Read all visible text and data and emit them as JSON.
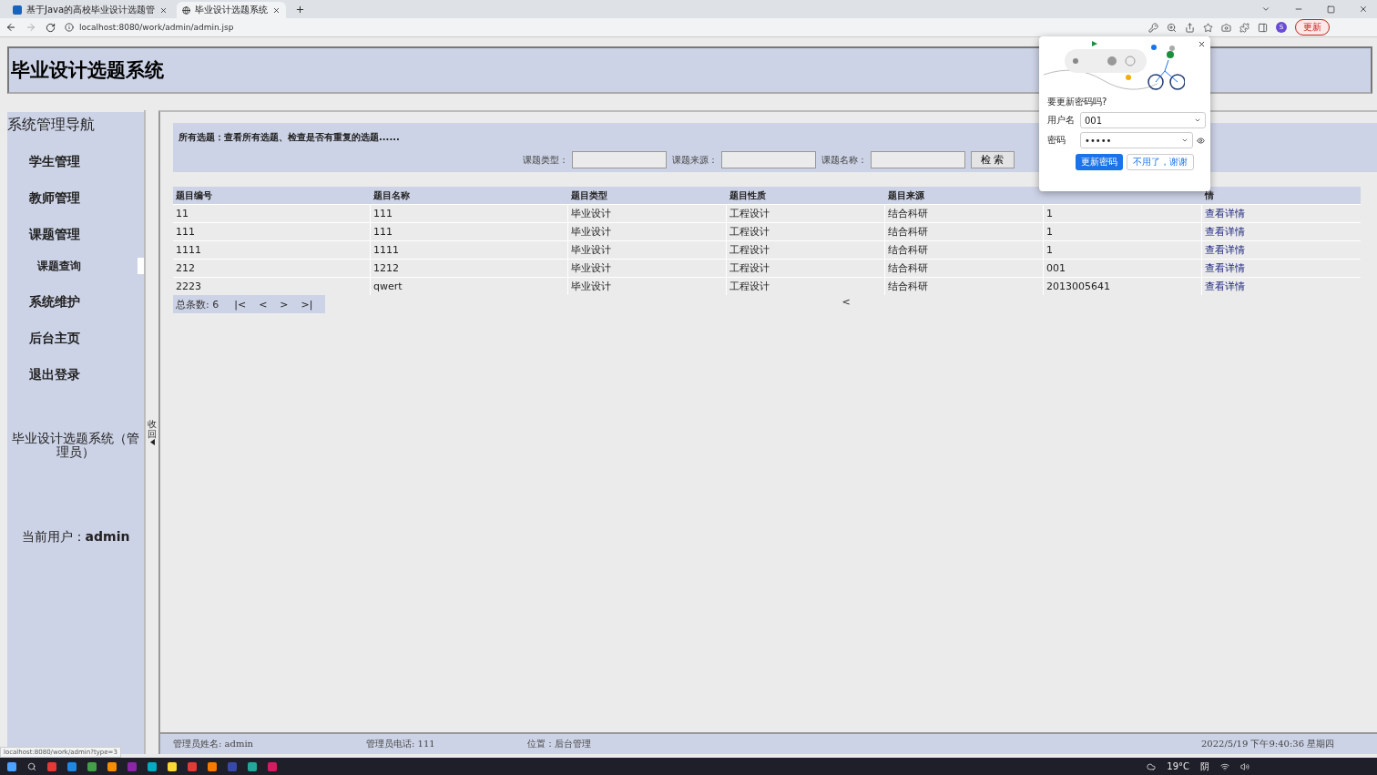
{
  "browser": {
    "tabs": [
      {
        "title": "基于Java的高校毕业设计选题管",
        "selected": false
      },
      {
        "title": "毕业设计选题系统",
        "selected": true
      }
    ],
    "url": "localhost:8080/work/admin/admin.jsp",
    "profile": "S",
    "update_button": "更新"
  },
  "header": {
    "title": "毕业设计选题系统"
  },
  "sidebar": {
    "heading": "系统管理导航",
    "items": [
      {
        "label": "学生管理",
        "kind": "main",
        "selected": false
      },
      {
        "label": "教师管理",
        "kind": "main",
        "selected": false
      },
      {
        "label": "课题管理",
        "kind": "main",
        "selected": false
      },
      {
        "label": "课题查询",
        "kind": "sub",
        "selected": true
      },
      {
        "label": "系统维护",
        "kind": "main",
        "selected": false
      },
      {
        "label": "后台主页",
        "kind": "main",
        "selected": false
      },
      {
        "label": "退出登录",
        "kind": "main",
        "selected": false
      }
    ],
    "note": "毕业设计选题系统（管理员）",
    "user_label": "当前用户：",
    "user": "admin",
    "collapse": "收回"
  },
  "search": {
    "description": "所有选题：查看所有选题、检查是否有重复的选题......",
    "fields": [
      {
        "label": "课题类型："
      },
      {
        "label": "课题来源："
      },
      {
        "label": "课题名称："
      }
    ],
    "button": "检 索"
  },
  "table": {
    "columns": [
      {
        "label": "题目编号"
      },
      {
        "label": "题目名称"
      },
      {
        "label": "题目类型"
      },
      {
        "label": "题目性质"
      },
      {
        "label": "题目来源"
      },
      {},
      {
        "label": "情"
      }
    ],
    "rows": [
      {
        "cells": [
          "11",
          "111",
          "毕业设计",
          "工程设计",
          "结合科研",
          "1"
        ],
        "link": "查看详情"
      },
      {
        "cells": [
          "111",
          "111",
          "毕业设计",
          "工程设计",
          "结合科研",
          "1"
        ],
        "link": "查看详情"
      },
      {
        "cells": [
          "1111",
          "1111",
          "毕业设计",
          "工程设计",
          "结合科研",
          "1"
        ],
        "link": "查看详情"
      },
      {
        "cells": [
          "212",
          "1212",
          "毕业设计",
          "工程设计",
          "结合科研",
          "001"
        ],
        "link": "查看详情"
      },
      {
        "cells": [
          "2223",
          "qwert",
          "毕业设计",
          "工程设计",
          "结合科研",
          "2013005641"
        ],
        "link": "查看详情"
      }
    ]
  },
  "pagination": {
    "total": "总条数: 6",
    "buttons": [
      "|<",
      "<",
      ">",
      ">|"
    ],
    "stray": "<"
  },
  "footer": [
    "管理员姓名: admin",
    "管理员电话: 111",
    "位置：后台管理",
    "2022/5/19 下午9:40:36 星期四"
  ],
  "popup": {
    "title": "要更新密码吗?",
    "fields": [
      {
        "label": "用户名",
        "value": "001"
      },
      {
        "label": "密码",
        "value": "•••••",
        "kind": "password"
      }
    ],
    "primary": "更新密码",
    "secondary": "不用了，谢谢"
  },
  "status_url": "localhost:8080/work/admin?type=3",
  "taskbar": {
    "temperature": "19°C",
    "weather": "阴"
  }
}
